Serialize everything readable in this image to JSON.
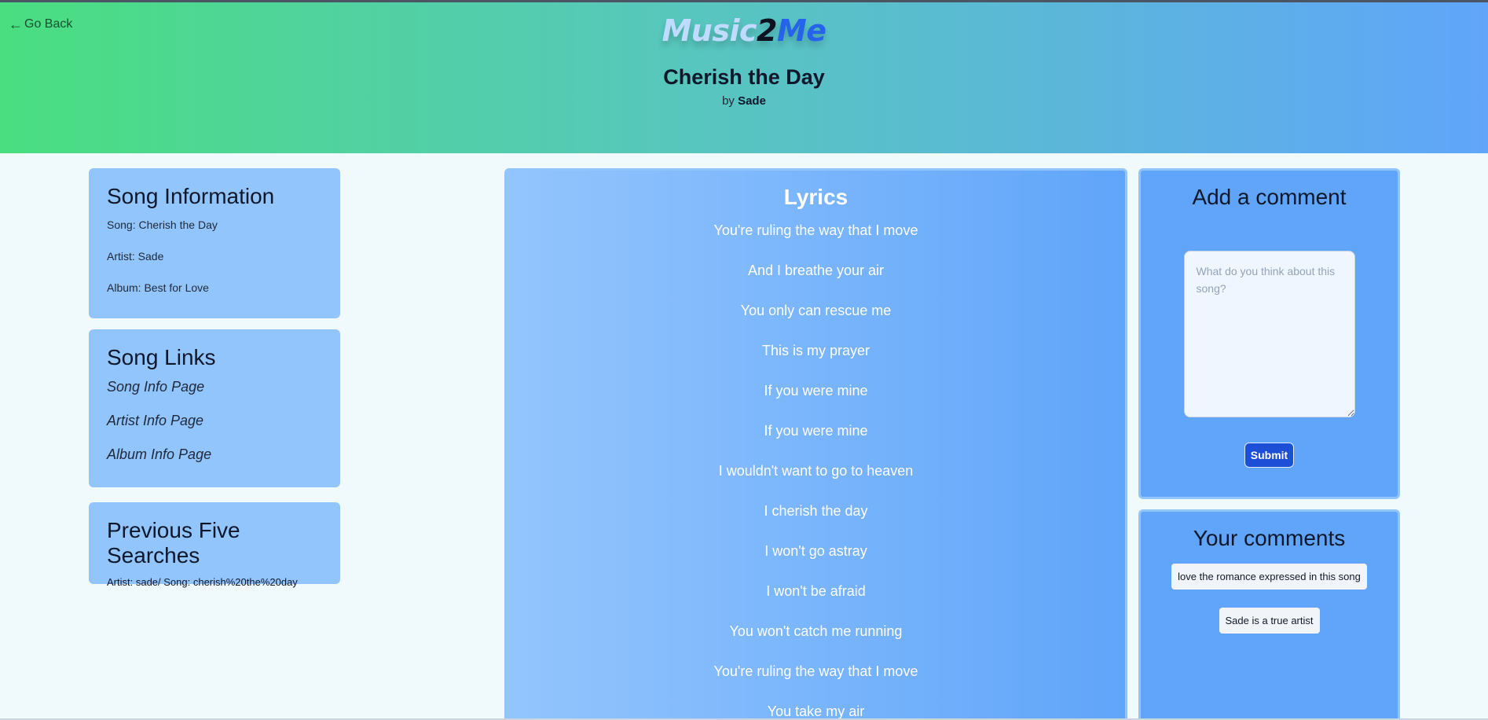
{
  "header": {
    "go_back": "Go Back",
    "logo": {
      "part1": "Music",
      "part2": "2",
      "part3": "Me"
    },
    "title": "Cherish the Day",
    "by_label": "by",
    "artist": "Sade"
  },
  "song_info": {
    "heading": "Song Information",
    "song": "Song: Cherish the Day",
    "artist": "Artist: Sade",
    "album": "Album: Best for Love"
  },
  "song_links": {
    "heading": "Song Links",
    "items": [
      "Song Info Page",
      "Artist Info Page",
      "Album Info Page"
    ]
  },
  "previous_searches": {
    "heading": "Previous Five Searches",
    "items": [
      "Artist: sade/ Song: cherish%20the%20day"
    ]
  },
  "lyrics": {
    "heading": "Lyrics",
    "lines": [
      "You're ruling the way that I move",
      "And I breathe your air",
      "You only can rescue me",
      "This is my prayer",
      "If you were mine",
      "If you were mine",
      "I wouldn't want to go to heaven",
      "I cherish the day",
      "I won't go astray",
      "I won't be afraid",
      "You won't catch me running",
      "You're ruling the way that I move",
      "You take my air"
    ]
  },
  "add_comment": {
    "heading": "Add a comment",
    "placeholder": "What do you think about this song?",
    "submit_label": "Submit"
  },
  "your_comments": {
    "heading": "Your comments",
    "items": [
      "love the romance expressed in this song",
      "Sade is a true artist"
    ]
  }
}
